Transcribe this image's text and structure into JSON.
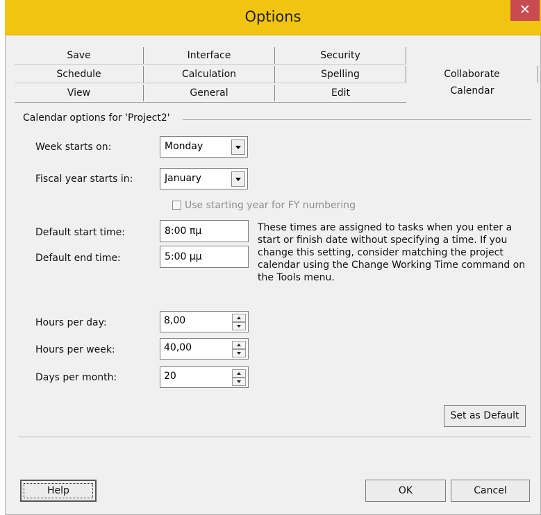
{
  "window": {
    "title": "Options"
  },
  "tabs": {
    "row1": [
      "Save",
      "Interface",
      "Security"
    ],
    "row2": [
      "Schedule",
      "Calculation",
      "Spelling",
      "Collaborate"
    ],
    "row3": [
      "View",
      "General",
      "Edit",
      "Calendar"
    ],
    "active": "Calendar"
  },
  "calendar": {
    "group_label": "Calendar options for 'Project2'",
    "week_starts_label": "Week starts on:",
    "week_starts_value": "Monday",
    "fiscal_year_label": "Fiscal year starts in:",
    "fiscal_year_value": "January",
    "fy_numbering_label": "Use starting year for FY numbering",
    "fy_numbering_checked": false,
    "default_start_label": "Default start time:",
    "default_start_value": "8:00 πμ",
    "default_end_label": "Default end time:",
    "default_end_value": "5:00 μμ",
    "times_note": "These times are assigned to tasks when you enter a start or finish date without specifying a time. If you change this setting, consider matching the project calendar using the Change Working Time command on the Tools menu.",
    "hours_per_day_label": "Hours per day:",
    "hours_per_day_value": "8,00",
    "hours_per_week_label": "Hours per week:",
    "hours_per_week_value": "40,00",
    "days_per_month_label": "Days per month:",
    "days_per_month_value": "20"
  },
  "buttons": {
    "set_default": "Set as Default",
    "help": "Help",
    "ok": "OK",
    "cancel": "Cancel"
  }
}
